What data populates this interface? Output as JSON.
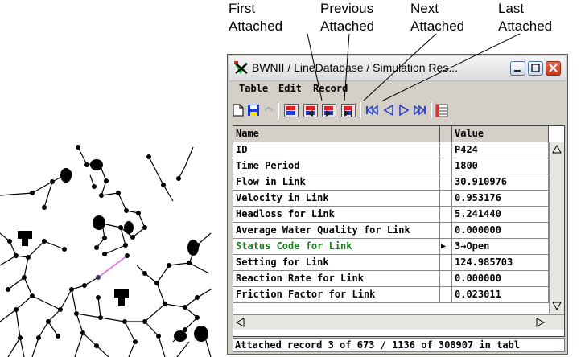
{
  "callouts": [
    {
      "line1": "First",
      "line2": "Attached"
    },
    {
      "line1": "Previous",
      "line2": "Attached"
    },
    {
      "line1": "Next",
      "line2": "Attached"
    },
    {
      "line1": "Last",
      "line2": "Attached"
    }
  ],
  "window": {
    "title": "BWNII / LineDatabase / Simulation Res..."
  },
  "menu": [
    "Table",
    "Edit",
    "Record"
  ],
  "table": {
    "columns": [
      "Name",
      "Value"
    ],
    "rows": [
      {
        "name": "ID",
        "value": "P424"
      },
      {
        "name": "Time Period",
        "value": "1800"
      },
      {
        "name": "Flow in Link",
        "value": "30.910976"
      },
      {
        "name": "Velocity in Link",
        "value": "0.953176"
      },
      {
        "name": "Headloss for Link",
        "value": "5.241440"
      },
      {
        "name": "Average Water Quality for Link",
        "value": "0.000000"
      },
      {
        "name": "Status Code for Link",
        "value": "3→Open",
        "marker": "▶"
      },
      {
        "name": "Setting for Link",
        "value": "124.985703"
      },
      {
        "name": "Reaction Rate for Link",
        "value": "0.000000"
      },
      {
        "name": "Friction Factor for Link",
        "value": "0.023011"
      }
    ]
  },
  "status": "Attached record 3 of 673 / 1136 of 308907 in tabl",
  "colors": {
    "highlight_link": "#e080e0",
    "status_text": "#1b7a1b"
  }
}
